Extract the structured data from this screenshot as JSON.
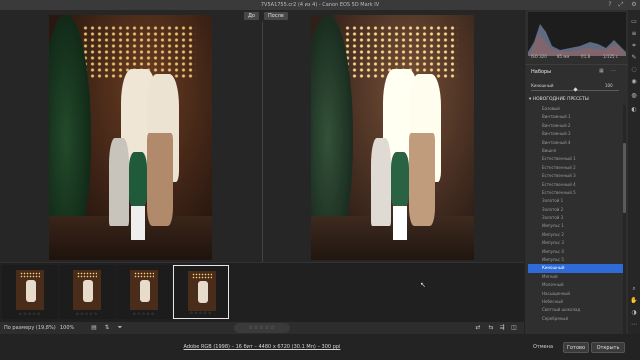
{
  "titlebar": {
    "title": "7V5A1755.cr2 (4 из 4) - Canon EOS 5D Mark IV"
  },
  "view": {
    "before_label": "До",
    "after_label": "После"
  },
  "filmstrip": {
    "thumbnails": [
      {
        "stars": "☆☆☆☆☆",
        "selected": false
      },
      {
        "stars": "☆☆☆☆☆",
        "selected": false
      },
      {
        "stars": "☆☆☆☆☆",
        "selected": false
      },
      {
        "stars": "☆☆☆☆☆",
        "selected": true
      }
    ]
  },
  "bottombar": {
    "zoom_label": "По размеру (19,8%)",
    "zoom_percent": "100%",
    "rating": "☆☆☆☆☆"
  },
  "status": {
    "file_info": "Adobe RGB (1998) – 16 бит – 4480 x 6720 (30.1 Мп) – 300 ppi"
  },
  "buttons": {
    "cancel": "Отмена",
    "done": "Готово",
    "open": "Открыть"
  },
  "camera": {
    "iso": "ISO 320",
    "focal": "85 мм",
    "aperture": "f/1.8",
    "shutter": "1/125 с"
  },
  "presets_panel": {
    "title": "Наборы",
    "amount_label": "Киношный",
    "amount_value": "100",
    "amount_fraction": 0.5,
    "group": "НОВОГОДНИЕ ПРЕСЕТЫ",
    "items": [
      "Базовый",
      "Винтажный 1",
      "Винтажный 2",
      "Винтажный 3",
      "Винтажный 4",
      "Вишня",
      "Естественный 1",
      "Естественный 2",
      "Естественный 3",
      "Естественный 4",
      "Естественный 5",
      "Золотой 1",
      "Золотой 2",
      "Золотой 3",
      "Импульс 1",
      "Импульс 2",
      "Импульс 3",
      "Импульс 4",
      "Импульс 5",
      "Киношный",
      "Мягкий",
      "Молочный",
      "Насыщенный",
      "Небесный",
      "Светлый шоколад",
      "Серебряный"
    ],
    "active_index": 19
  },
  "tools": [
    "histogram-icon",
    "edit-icon",
    "crop-icon",
    "brush-icon",
    "mask-icon",
    "redeye-icon",
    "presets-icon",
    "snapshot-icon",
    "zoom-icon",
    "hand-icon",
    "toggle-icon",
    "more-icon"
  ]
}
